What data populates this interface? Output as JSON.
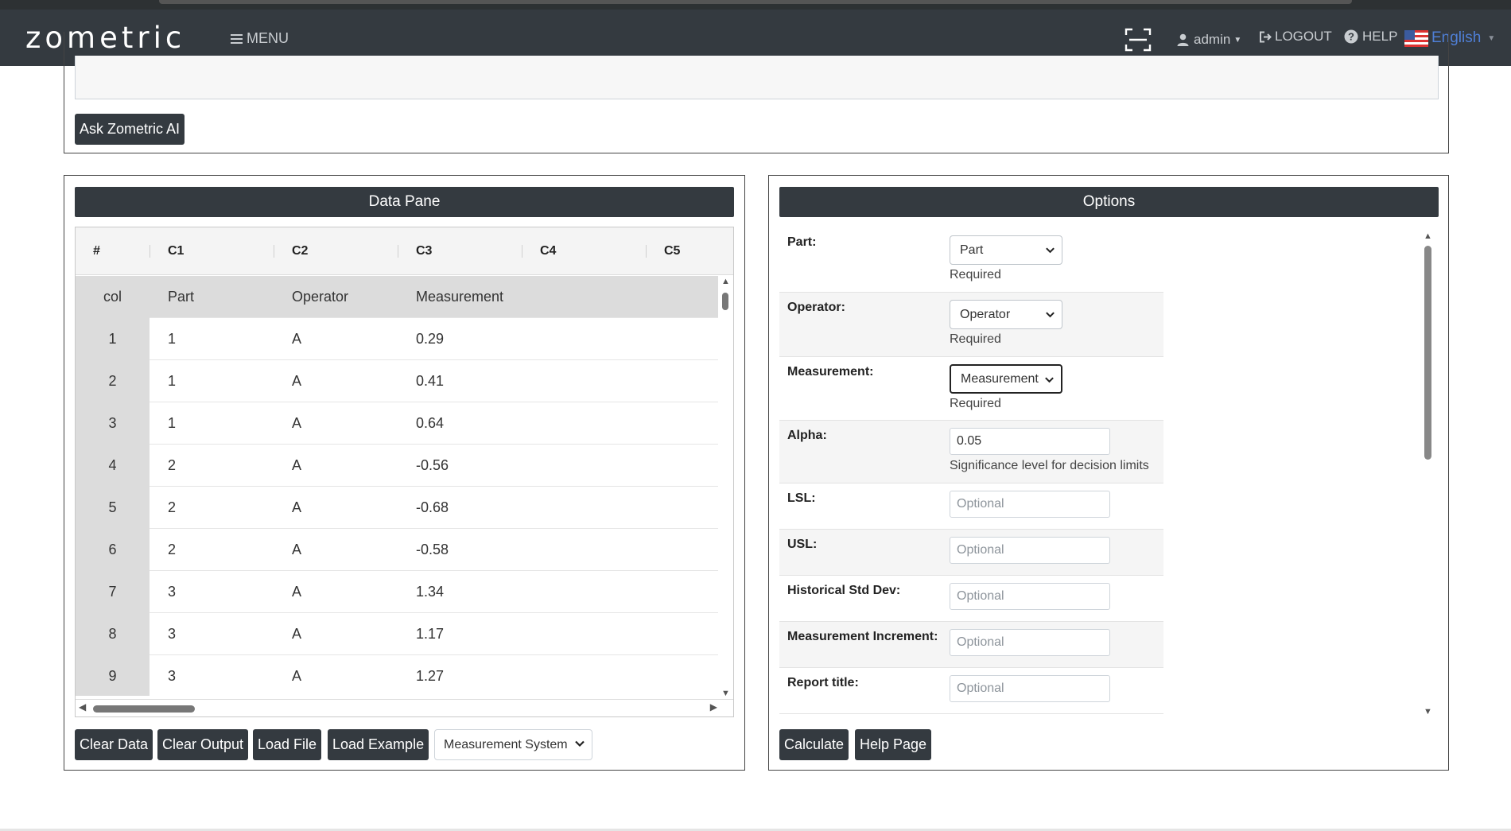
{
  "navbar": {
    "logo": "zometric",
    "menu_label": "MENU",
    "user_label": "admin",
    "logout_label": "LOGOUT",
    "help_label": "HELP",
    "language_label": "English"
  },
  "ai": {
    "ask_button": "Ask Zometric AI"
  },
  "data_pane": {
    "title": "Data Pane",
    "column_headers": [
      "#",
      "C1",
      "C2",
      "C3",
      "C4",
      "C5"
    ],
    "name_row": {
      "rownum": "col",
      "c1": "Part",
      "c2": "Operator",
      "c3": "Measurement"
    },
    "rows": [
      {
        "rownum": "1",
        "c1": "1",
        "c2": "A",
        "c3": "0.29"
      },
      {
        "rownum": "2",
        "c1": "1",
        "c2": "A",
        "c3": "0.41"
      },
      {
        "rownum": "3",
        "c1": "1",
        "c2": "A",
        "c3": "0.64"
      },
      {
        "rownum": "4",
        "c1": "2",
        "c2": "A",
        "c3": "-0.56"
      },
      {
        "rownum": "5",
        "c1": "2",
        "c2": "A",
        "c3": "-0.68"
      },
      {
        "rownum": "6",
        "c1": "2",
        "c2": "A",
        "c3": "-0.58"
      },
      {
        "rownum": "7",
        "c1": "3",
        "c2": "A",
        "c3": "1.34"
      },
      {
        "rownum": "8",
        "c1": "3",
        "c2": "A",
        "c3": "1.17"
      },
      {
        "rownum": "9",
        "c1": "3",
        "c2": "A",
        "c3": "1.27"
      }
    ],
    "buttons": {
      "clear_data": "Clear Data",
      "clear_output": "Clear Output",
      "load_file": "Load File",
      "load_example": "Load Example"
    },
    "example_select": "Measurement System"
  },
  "options": {
    "title": "Options",
    "part": {
      "label": "Part:",
      "value": "Part",
      "help": "Required"
    },
    "operator": {
      "label": "Operator:",
      "value": "Operator",
      "help": "Required"
    },
    "measurement": {
      "label": "Measurement:",
      "value": "Measurement",
      "help": "Required"
    },
    "alpha": {
      "label": "Alpha:",
      "value": "0.05",
      "help": "Significance level for decision limits"
    },
    "lsl": {
      "label": "LSL:",
      "placeholder": "Optional"
    },
    "usl": {
      "label": "USL:",
      "placeholder": "Optional"
    },
    "hist_std": {
      "label": "Historical Std Dev:",
      "placeholder": "Optional"
    },
    "meas_inc": {
      "label": "Measurement Increment:",
      "placeholder": "Optional"
    },
    "report_title": {
      "label": "Report title:",
      "placeholder": "Optional"
    },
    "buttons": {
      "calculate": "Calculate",
      "help_page": "Help Page"
    }
  },
  "colors": {
    "navbar": "#343a40",
    "header_bar": "#343a40",
    "row_number_bg": "#dcdcdc",
    "language_link": "#4f7fd6"
  }
}
